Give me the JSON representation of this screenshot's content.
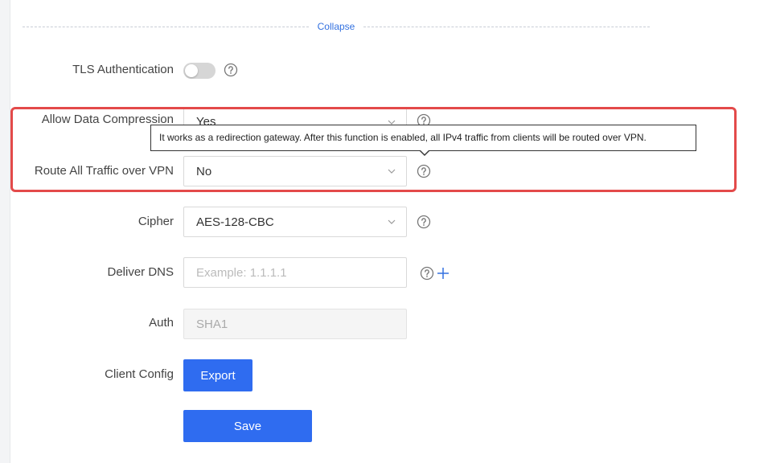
{
  "collapse_label": "Collapse",
  "fields": {
    "tls_auth": {
      "label": "TLS Authentication",
      "enabled": false
    },
    "compression": {
      "label": "Allow Data Compression",
      "value": "Yes"
    },
    "route_all": {
      "label": "Route All Traffic over VPN",
      "value": "No"
    },
    "cipher": {
      "label": "Cipher",
      "value": "AES-128-CBC"
    },
    "deliver_dns": {
      "label": "Deliver DNS",
      "placeholder": "Example: 1.1.1.1"
    },
    "auth": {
      "label": "Auth",
      "value": "SHA1"
    },
    "client_config": {
      "label": "Client Config",
      "button": "Export"
    }
  },
  "tooltip": "It works as a redirection gateway. After this function is enabled, all IPv4 traffic from clients will be routed over VPN.",
  "save_label": "Save",
  "colors": {
    "primary": "#2f6cf0",
    "highlight": "#e34a4a",
    "link": "#3371e0"
  },
  "icons": {
    "help": "question-circle-icon",
    "chevron": "chevron-down-icon",
    "add": "plus-icon"
  }
}
